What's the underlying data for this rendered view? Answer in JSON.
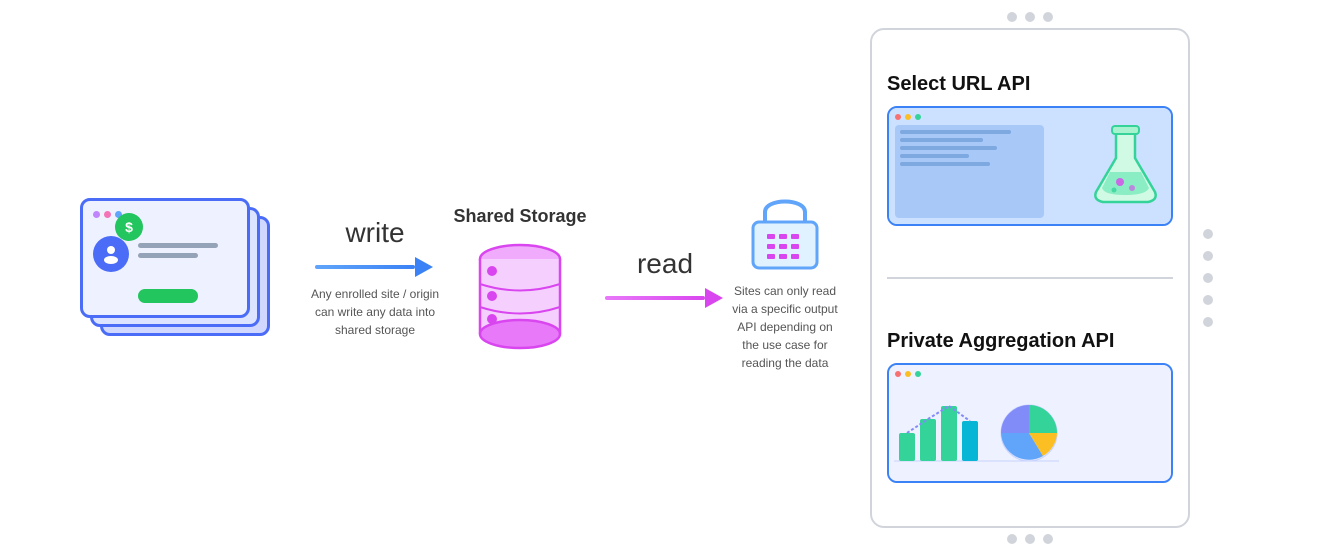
{
  "diagram": {
    "write_label": "write",
    "read_label": "read",
    "shared_storage_label": "Shared Storage",
    "write_desc": "Any enrolled site / origin can write any data into shared storage",
    "read_desc": "Sites can only read via a specific output API depending on the use case for reading the data",
    "api_panel": {
      "select_url_title": "Select URL API",
      "private_agg_title": "Private Aggregation API"
    }
  }
}
